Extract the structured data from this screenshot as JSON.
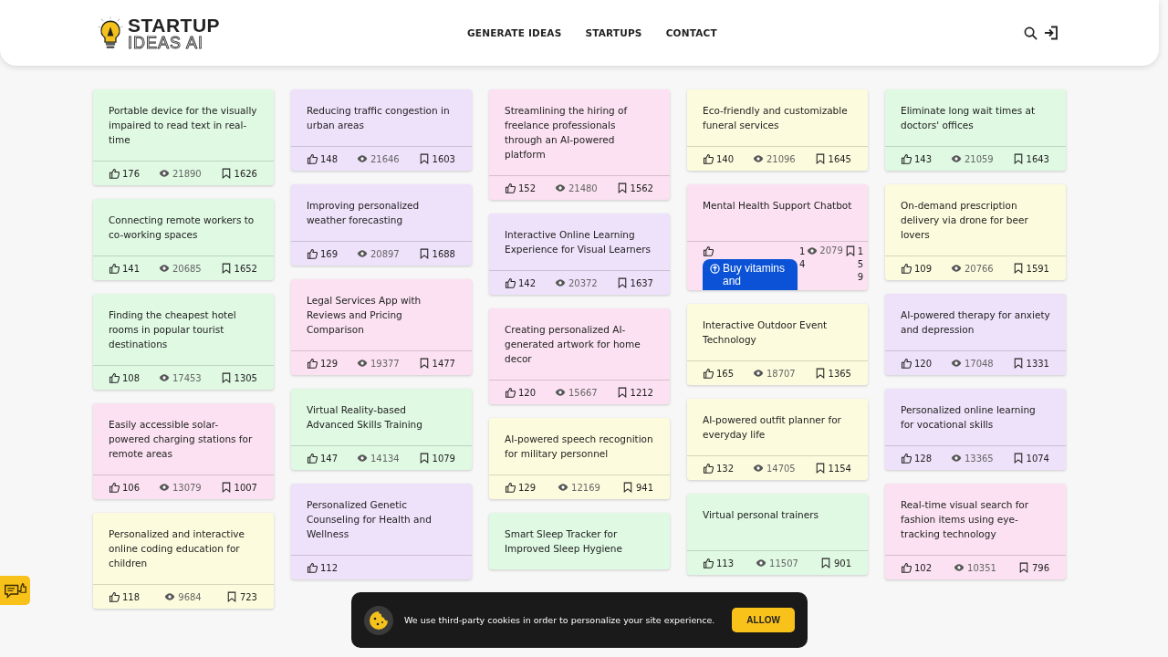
{
  "logo": {
    "line1": "STARTUP",
    "line2": "IDEAS AI"
  },
  "nav": [
    "GENERATE IDEAS",
    "STARTUPS",
    "CONTACT"
  ],
  "columns": [
    {
      "cards": [
        {
          "kind": "normal",
          "title": "Portable device for the visually impaired to read text in real-time",
          "color": "#dff9e3",
          "likes": "176",
          "views": "21890",
          "saves": "1626"
        },
        {
          "kind": "normal",
          "title": "Connecting remote workers to co-working spaces",
          "color": "#dff9e3",
          "likes": "141",
          "views": "20685",
          "saves": "1652"
        },
        {
          "kind": "normal",
          "title": "Finding the cheapest hotel rooms in popular tourist destinations",
          "color": "#dff9e3",
          "likes": "108",
          "views": "17453",
          "saves": "1305"
        },
        {
          "kind": "normal",
          "title": "Easily accessible solar-powered charging stations for remote areas",
          "color": "#fbe1f1",
          "likes": "106",
          "views": "13079",
          "saves": "1007"
        },
        {
          "kind": "normal",
          "title": "Personalized and interactive online coding education for children",
          "color": "#fdfbdd",
          "likes": "118",
          "views": "9684",
          "saves": "723"
        }
      ]
    },
    {
      "cards": [
        {
          "kind": "normal",
          "title": "Reducing traffic congestion in urban areas",
          "color": "#eee1fa",
          "likes": "148",
          "views": "21646",
          "saves": "1603"
        },
        {
          "kind": "normal",
          "title": "Improving personalized weather forecasting",
          "color": "#eee1fa",
          "likes": "169",
          "views": "20897",
          "saves": "1688"
        },
        {
          "kind": "normal",
          "title": "Legal Services App with Reviews and Pricing Comparison",
          "color": "#fbe1f1",
          "likes": "129",
          "views": "19377",
          "saves": "1477"
        },
        {
          "kind": "normal",
          "title": "Virtual Reality-based Advanced Skills Training",
          "color": "#dff9e3",
          "likes": "147",
          "views": "14134",
          "saves": "1079"
        },
        {
          "kind": "normal",
          "title": "Personalized Genetic Counseling for Health and Wellness",
          "color": "#eee1fa",
          "likes": "112"
        }
      ]
    },
    {
      "cards": [
        {
          "kind": "normal",
          "title": "Streamlining the hiring of freelance professionals through an AI-powered platform",
          "color": "#fbe1f1",
          "likes": "152",
          "views": "21480",
          "saves": "1562"
        },
        {
          "kind": "normal",
          "title": "Interactive Online Learning Experience for Visual Learners",
          "color": "#eee1fa",
          "likes": "142",
          "views": "20372",
          "saves": "1637"
        },
        {
          "kind": "normal",
          "title": "Creating personalized AI-generated artwork for home decor",
          "color": "#fbe1f1",
          "likes": "120",
          "views": "15667",
          "saves": "1212"
        },
        {
          "kind": "normal",
          "title": "AI-powered speech recognition for military personnel",
          "color": "#fdfbdd",
          "likes": "129",
          "views": "12169",
          "saves": "941"
        },
        {
          "kind": "normal",
          "title": "Smart Sleep Tracker for Improved Sleep Hygiene",
          "color": "#dff9e3"
        }
      ]
    },
    {
      "cards": [
        {
          "kind": "normal",
          "title": "Eco-friendly and customizable funeral services",
          "color": "#fdfbdd",
          "likes": "140",
          "views": "21096",
          "saves": "1645"
        },
        {
          "kind": "squeezed",
          "title": "Mental Health Support Chatbot",
          "color": "#fbe1f1",
          "ad": "Buy vitamins and",
          "likes": "14",
          "views": "2079",
          "saves": "159"
        },
        {
          "kind": "normal",
          "title": "Interactive Outdoor Event Technology",
          "color": "#fdfbdd",
          "likes": "165",
          "views": "18707",
          "saves": "1365"
        },
        {
          "kind": "normal",
          "title": "AI-powered outfit planner for everyday life",
          "color": "#fdfbdd",
          "likes": "132",
          "views": "14705",
          "saves": "1154"
        },
        {
          "kind": "normal",
          "title": "Virtual personal trainers",
          "color": "#dff9e3",
          "likes": "113",
          "views": "11507",
          "saves": "901"
        }
      ]
    },
    {
      "cards": [
        {
          "kind": "normal",
          "title": "Eliminate long wait times at doctors' offices",
          "color": "#dff9e3",
          "likes": "143",
          "views": "21059",
          "saves": "1643"
        },
        {
          "kind": "normal",
          "title": "On-demand prescription delivery via drone for beer lovers",
          "color": "#fdfbdd",
          "likes": "109",
          "views": "20766",
          "saves": "1591"
        },
        {
          "kind": "normal",
          "title": "AI-powered therapy for anxiety and depression",
          "color": "#eee1fa",
          "likes": "120",
          "views": "17048",
          "saves": "1331"
        },
        {
          "kind": "normal",
          "title": "Personalized online learning for vocational skills",
          "color": "#eee1fa",
          "likes": "128",
          "views": "13365",
          "saves": "1074"
        },
        {
          "kind": "normal",
          "title": "Real-time visual search for fashion items using eye-tracking technology",
          "color": "#fbe1f1",
          "likes": "102",
          "views": "10351",
          "saves": "796"
        }
      ]
    }
  ],
  "cookie": {
    "text": "We use third-party cookies in order to personalize your site experience.",
    "button": "ALLOW"
  }
}
